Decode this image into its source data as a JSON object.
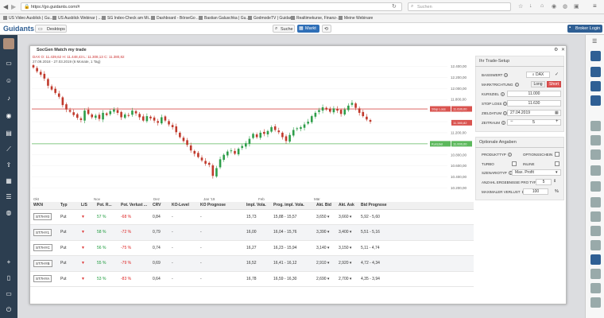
{
  "browser": {
    "url": "https://go.guidants.com/#",
    "search_placeholder": "Suchen",
    "bookmarks": [
      "US Video Ausblick | Gu...",
      "US Ausblick Webinar | ...",
      "SG Index-Check am Mi...",
      "Dashboard - BörseGo ...",
      "Bastian Galuschka | Gu...",
      "GodmodeTV | Guidants",
      "Realtimekurse, Finanz-...",
      "Meine Webinare"
    ]
  },
  "app": {
    "logo": "Guidants",
    "desktops_label": "Desktops",
    "search_label": "Suche",
    "markt_label": "Markt",
    "broker_login_label": "Broker Login"
  },
  "modal": {
    "title": "SocGen Match my trade"
  },
  "chart_data": {
    "type": "candlestick",
    "title": "SocGen Match my trade",
    "instrument_line": "DAX O: 11.439,62 H: 11.448,43 L: 11.308,13 C: 11.380,82",
    "period_line": "27.09.2018 - 27.03.2019 (6 Monate, 1 Tag)",
    "x_tick_labels": [
      "Okt",
      "Nov",
      "Dez",
      "Jan '19",
      "Feb",
      "Mär"
    ],
    "y_tick_labels": [
      "12.400,00",
      "12.200,00",
      "12.000,00",
      "11.800,00",
      "11.600,00",
      "11.400,00",
      "11.200,00",
      "11.000,00",
      "10.800,00",
      "10.600,00",
      "10.400,00",
      "10.200,00"
    ],
    "ylim": [
      10150,
      12450
    ],
    "markers": [
      {
        "label": "Stop Loss",
        "value": "11.630,00",
        "color": "#d9534f"
      },
      {
        "label": "",
        "value": "11.380,82",
        "color": "#d9534f"
      },
      {
        "label": "Kursziel",
        "value": "11.000,00",
        "color": "#5cb85c"
      }
    ],
    "closes": [
      12380,
      12310,
      12250,
      12180,
      12050,
      11980,
      11920,
      11850,
      11700,
      11620,
      11580,
      11520,
      11470,
      11430,
      11600,
      11540,
      11480,
      11510,
      11450,
      11560,
      11520,
      11590,
      11620,
      11560,
      11480,
      11530,
      11510,
      11600,
      11550,
      11480,
      11420,
      11500,
      11460,
      11420,
      11380,
      11480,
      11420,
      11350,
      11300,
      11210,
      11120,
      11050,
      10980,
      10880,
      10820,
      10760,
      10700,
      10640,
      10620,
      10420,
      10560,
      10720,
      10800,
      10860,
      10880,
      10820,
      10910,
      10960,
      11010,
      11090,
      11180,
      11120,
      11200,
      11180,
      11230,
      11300,
      11250,
      11210,
      11120,
      11050,
      11160,
      11250,
      11280,
      11300,
      11350,
      11400,
      11500,
      11560,
      11610,
      11660,
      11620,
      11580,
      11640,
      11600,
      11540,
      11620,
      11690,
      11740,
      11650,
      11560,
      11500,
      11440,
      11400
    ]
  },
  "table": {
    "headers": [
      "WKN",
      "Typ",
      "L/S",
      "Pot. R...",
      "Pot. Verlust ...",
      "CRV",
      "KO-Level",
      "KO Prognose",
      "Impl. Vola.",
      "Prog. impl. Vola.",
      "Akt. Bid",
      "Akt. Ask",
      "Bid Prognose"
    ],
    "rows": [
      {
        "wkn": "ST7HY0",
        "typ": "Put",
        "ls": "▼",
        "pot_r": "57 %",
        "pot_v": "-68 %",
        "crv": "0,84",
        "ko": "-",
        "kop": "-",
        "iv": "15,73",
        "piv": "15,88 - 15,57",
        "bid": "3,650 ▾",
        "ask": "3,660 ▾",
        "bidp": "5,92 - 5,60"
      },
      {
        "wkn": "ST7HY1",
        "typ": "Put",
        "ls": "▼",
        "pot_r": "58 %",
        "pot_v": "-72 %",
        "crv": "0,79",
        "ko": "-",
        "kop": "-",
        "iv": "16,00",
        "piv": "16,04 - 15,76",
        "bid": "3,390 ▾",
        "ask": "3,400 ▾",
        "bidp": "5,51 - 5,16"
      },
      {
        "wkn": "ST7HYC",
        "typ": "Put",
        "ls": "▼",
        "pot_r": "56 %",
        "pot_v": "-75 %",
        "crv": "0,74",
        "ko": "-",
        "kop": "-",
        "iv": "16,27",
        "piv": "16,23 - 15,94",
        "bid": "3,140 ▾",
        "ask": "3,150 ▾",
        "bidp": "5,11 - 4,74"
      },
      {
        "wkn": "ST7HYB",
        "typ": "Put",
        "ls": "▼",
        "pot_r": "55 %",
        "pot_v": "-79 %",
        "crv": "0,69",
        "ko": "-",
        "kop": "-",
        "iv": "16,52",
        "piv": "16,41 - 16,12",
        "bid": "2,910 ▾",
        "ask": "2,920 ▾",
        "bidp": "4,72 - 4,34"
      },
      {
        "wkn": "ST7HYA",
        "typ": "Put",
        "ls": "▼",
        "pot_r": "53 %",
        "pot_v": "-83 %",
        "crv": "0,64",
        "ko": "-",
        "kop": "-",
        "iv": "16,78",
        "piv": "16,59 - 16,30",
        "bid": "2,690 ▾",
        "ask": "2,700 ▾",
        "bidp": "4,35 - 3,94"
      }
    ]
  },
  "setup": {
    "title": "Ihr Trade-Setup",
    "basiswert_label": "BASISWERT",
    "basiswert_value": "DAX",
    "marktrichtung_label": "MARKTRICHTUNG",
    "long_label": "Long",
    "short_label": "Short",
    "kursziel_label": "KURSZIEL",
    "kursziel_value": "11.000",
    "stoploss_label": "STOP LOSS",
    "stoploss_value": "11.630",
    "zieldatum_label": "ZIELDATUM",
    "zieldatum_value": "27.04.2019",
    "zeitraum_label": "ZEITRAUM",
    "zeitraum_minus": "−",
    "zeitraum_value": "5",
    "zeitraum_plus": "+"
  },
  "optional": {
    "title": "Optionale Angaben",
    "produkttyp_label": "PRODUKTTYP",
    "optionsschein_label": "OPTIONSSCHEIN",
    "turbo_label": "TURBO",
    "inline_label": "INLINE",
    "szenariotyp_label": "SZENARIOTYP",
    "szenariotyp_value": "Max. Profit",
    "anzahl_label": "ANZAHL ERGEBNISSE PRO TYP",
    "anzahl_value": "5",
    "maxverlust_label": "MAXIMALER VERLUST",
    "maxverlust_value": "100",
    "maxverlust_unit": "%"
  },
  "colors": {
    "accent": "#2f6fb7",
    "stop": "#d9534f",
    "target": "#5cb85c",
    "up": "#2e9e4a",
    "down": "#c0392b"
  }
}
